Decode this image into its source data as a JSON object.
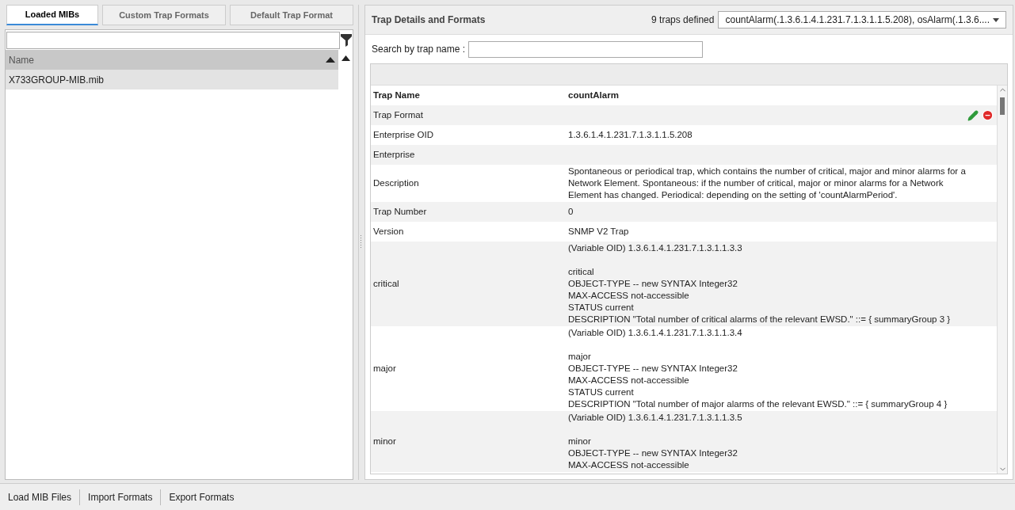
{
  "left_tabs": [
    {
      "label": "Loaded MIBs",
      "selected": true
    },
    {
      "label": "Custom Trap Formats",
      "selected": false
    },
    {
      "label": "Default Trap Format",
      "selected": false
    }
  ],
  "mib_table": {
    "columns": [
      "Name"
    ],
    "rows": [
      {
        "name": "X733GROUP-MIB.mib",
        "selected": true
      }
    ]
  },
  "details": {
    "title": "Trap Details and Formats",
    "count": "9 traps defined",
    "trap_select": "countAlarm(.1.3.6.1.4.1.231.7.1.3.1.1.5.208), osAlarm(.1.3.6....",
    "search_label": "Search by trap name :",
    "rows": [
      {
        "label": "Trap Name",
        "blocks": [
          [
            "countAlarm"
          ]
        ],
        "actions": false
      },
      {
        "label": "Trap Format",
        "actions": true
      },
      {
        "label": "Enterprise OID",
        "blocks": [
          [
            "1.3.6.1.4.1.231.7.1.3.1.1.5.208"
          ]
        ],
        "actions": false
      },
      {
        "label": "Enterprise",
        "actions": false
      },
      {
        "label": "Description",
        "blocks": [
          [
            "Spontaneous or periodical trap, which contains the number of critical, major and minor alarms for a",
            "Network Element. Spontaneous: if the number of critical, major or minor alarms for a Network",
            "Element has changed. Periodical: depending on the setting of 'countAlarmPeriod'."
          ]
        ],
        "actions": false
      },
      {
        "label": "Trap Number",
        "blocks": [
          [
            "0"
          ]
        ],
        "actions": false
      },
      {
        "label": "Version",
        "blocks": [
          [
            "SNMP V2 Trap"
          ]
        ],
        "actions": false
      },
      {
        "label": "critical",
        "blocks": [
          [
            "(Variable OID) 1.3.6.1.4.1.231.7.1.3.1.1.3.3"
          ],
          [
            "critical",
            "OBJECT-TYPE -- new SYNTAX Integer32",
            "MAX-ACCESS not-accessible",
            "STATUS current",
            "DESCRIPTION \"Total number of critical alarms of the relevant EWSD.\" ::= { summaryGroup 3 }"
          ]
        ],
        "actions": false
      },
      {
        "label": "major",
        "blocks": [
          [
            "(Variable OID) 1.3.6.1.4.1.231.7.1.3.1.1.3.4"
          ],
          [
            "major",
            "OBJECT-TYPE -- new SYNTAX Integer32",
            "MAX-ACCESS not-accessible",
            "STATUS current",
            "DESCRIPTION \"Total number of major alarms of the relevant EWSD.\" ::= { summaryGroup 4 }"
          ]
        ],
        "actions": false
      },
      {
        "label": "minor",
        "blocks": [
          [
            "(Variable OID) 1.3.6.1.4.1.231.7.1.3.1.1.3.5"
          ],
          [
            "minor",
            "OBJECT-TYPE -- new SYNTAX Integer32",
            "MAX-ACCESS not-accessible"
          ]
        ],
        "actions": false
      }
    ]
  },
  "bottom_buttons": [
    "Load MIB Files",
    "Import Formats",
    "Export Formats"
  ]
}
